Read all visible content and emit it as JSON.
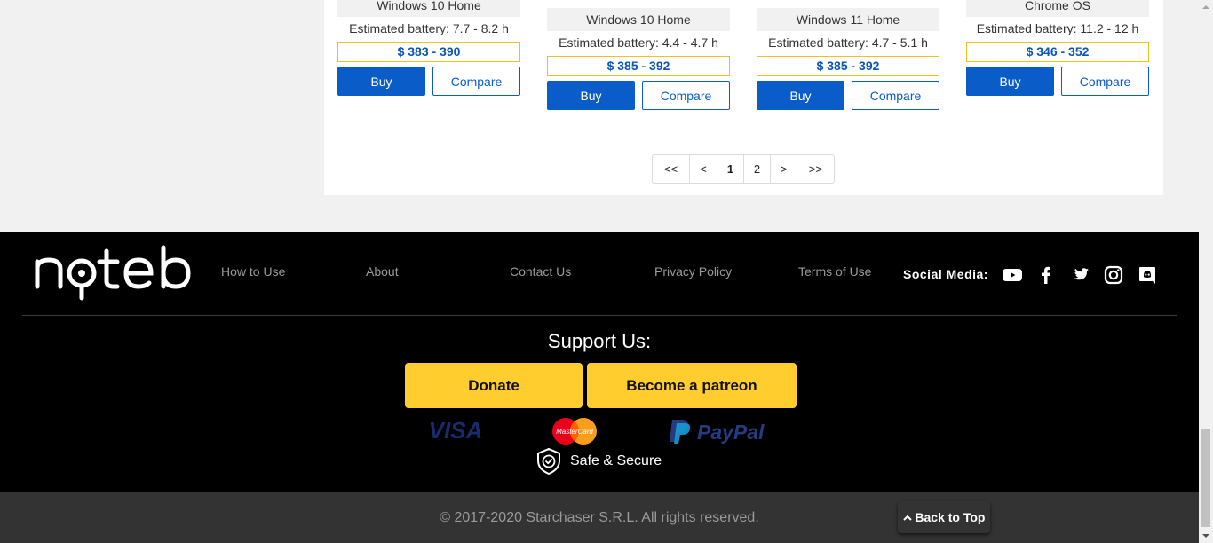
{
  "products": [
    {
      "os": "Windows 10 Home",
      "battery": "Estimated battery: 7.7 - 8.2 h",
      "price": "$ 383 - 390",
      "buy_label": "Buy",
      "compare_label": "Compare"
    },
    {
      "os": "Windows 10 Home",
      "battery": "Estimated battery: 4.4 - 4.7 h",
      "price": "$ 385 - 392",
      "buy_label": "Buy",
      "compare_label": "Compare"
    },
    {
      "os": "Windows 11 Home",
      "battery": "Estimated battery: 4.7 - 5.1 h",
      "price": "$ 385 - 392",
      "buy_label": "Buy",
      "compare_label": "Compare"
    },
    {
      "os": "Chrome OS",
      "battery": "Estimated battery: 11.2 - 12 h",
      "price": "$ 346 - 352",
      "buy_label": "Buy",
      "compare_label": "Compare"
    }
  ],
  "pagination": {
    "first": "<<",
    "prev": "<",
    "pages": [
      "1",
      "2"
    ],
    "current": "1",
    "next": ">",
    "last": ">>"
  },
  "footer": {
    "brand": "noteb",
    "nav": [
      "How to Use",
      "About",
      "Contact Us",
      "Privacy Policy",
      "Terms of Use"
    ],
    "social_label": "Social Media:",
    "social_icons": [
      "youtube-icon",
      "facebook-icon",
      "twitter-icon",
      "instagram-icon",
      "discord-icon"
    ],
    "support_title": "Support Us:",
    "donate_label": "Donate",
    "patreon_label": "Become a patreon",
    "payment_logos": [
      "VISA",
      "MasterCard",
      "PayPal"
    ],
    "secure_label": "Safe & Secure",
    "copyright": "© 2017-2020 Starchaser S.R.L. All rights reserved.",
    "back_to_top": "Back to Top"
  },
  "colors": {
    "primary_blue": "#0a5cc8",
    "price_border": "#f0c020",
    "support_yellow": "#ffcd2e",
    "footer_bg": "#000000",
    "bottom_bar_bg": "#333333"
  }
}
